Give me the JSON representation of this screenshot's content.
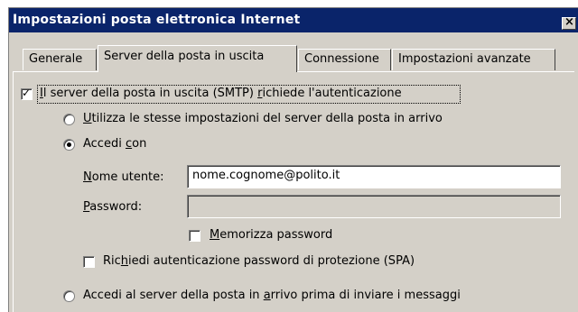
{
  "window": {
    "title": "Impostazioni posta elettronica Internet",
    "close_glyph": "×"
  },
  "tabs": [
    {
      "label": "Generale",
      "active": false
    },
    {
      "label": "Server della posta in uscita",
      "active": true
    },
    {
      "label": "Connessione",
      "active": false
    },
    {
      "label": "Impostazioni avanzate",
      "active": false
    }
  ],
  "smtp_auth": {
    "checked": true,
    "check_glyph": "✓",
    "label_mnemonic": "I",
    "label_mid": "l server della posta in uscita (SMTP) ",
    "label_mnemonic2": "r",
    "label_rest": "ichiede l'autenticazione"
  },
  "option_same_settings": {
    "selected": false,
    "mnemonic": "U",
    "label_rest": "tilizza le stesse impostazioni del server della posta in arrivo"
  },
  "option_login": {
    "selected": true,
    "label_pre": "Accedi ",
    "mnemonic": "c",
    "label_rest": "on"
  },
  "username": {
    "label_mnemonic": "N",
    "label_rest": "ome utente:",
    "value": "nome.cognome@polito.it"
  },
  "password": {
    "label_mnemonic": "P",
    "label_rest": "assword:",
    "value": ""
  },
  "remember_password": {
    "checked": false,
    "mnemonic": "M",
    "label_rest": "emorizza password"
  },
  "spa": {
    "checked": false,
    "label_pre": "Ric",
    "mnemonic": "h",
    "label_rest": "iedi autenticazione password di protezione (SPA)"
  },
  "option_pop_before_smtp": {
    "selected": false,
    "label_pre": "Accedi al server della posta in ",
    "mnemonic": "a",
    "label_rest": "rrivo prima di inviare i messaggi"
  }
}
